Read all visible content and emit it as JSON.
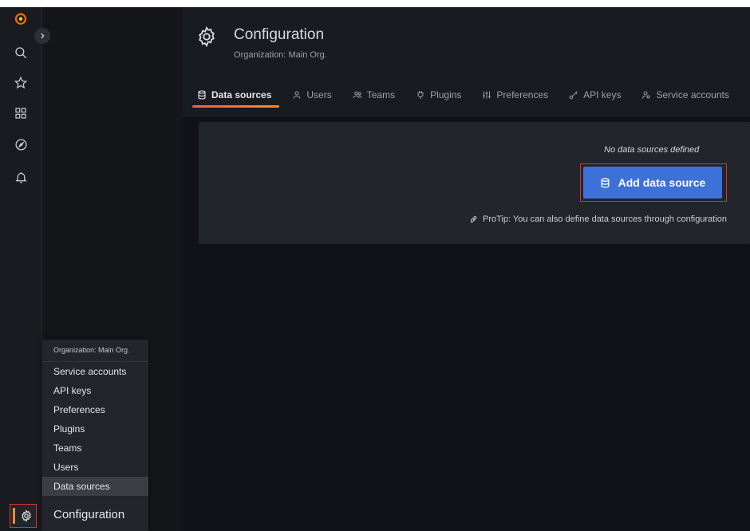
{
  "sidebar": {
    "logo": "grafana-logo-icon",
    "items": [
      {
        "icon": "search-icon",
        "label": "Search"
      },
      {
        "icon": "star-icon",
        "label": "Starred"
      },
      {
        "icon": "dashboards-icon",
        "label": "Dashboards"
      },
      {
        "icon": "explore-icon",
        "label": "Explore"
      },
      {
        "icon": "bell-icon",
        "label": "Alerting"
      }
    ],
    "config_icon": "gear-icon"
  },
  "header": {
    "title": "Configuration",
    "subtitle": "Organization: Main Org."
  },
  "tabs": [
    {
      "label": "Data sources",
      "icon": "database-icon",
      "active": true
    },
    {
      "label": "Users",
      "icon": "user-icon",
      "active": false
    },
    {
      "label": "Teams",
      "icon": "users-icon",
      "active": false
    },
    {
      "label": "Plugins",
      "icon": "plug-icon",
      "active": false
    },
    {
      "label": "Preferences",
      "icon": "sliders-icon",
      "active": false
    },
    {
      "label": "API keys",
      "icon": "key-icon",
      "active": false
    },
    {
      "label": "Service accounts",
      "icon": "user-cog-icon",
      "active": false
    }
  ],
  "empty_state": {
    "message": "No data sources defined",
    "button_label": "Add data source",
    "protip": "ProTip: You can also define data sources through configuration"
  },
  "flyout": {
    "header": "Organization: Main Org.",
    "items": [
      "Service accounts",
      "API keys",
      "Preferences",
      "Plugins",
      "Teams",
      "Users",
      "Data sources"
    ],
    "active_item": "Data sources",
    "title": "Configuration"
  },
  "colors": {
    "accent_orange": "#ff8833",
    "primary_blue": "#3d71d9",
    "highlight_red": "#e02f2f"
  }
}
